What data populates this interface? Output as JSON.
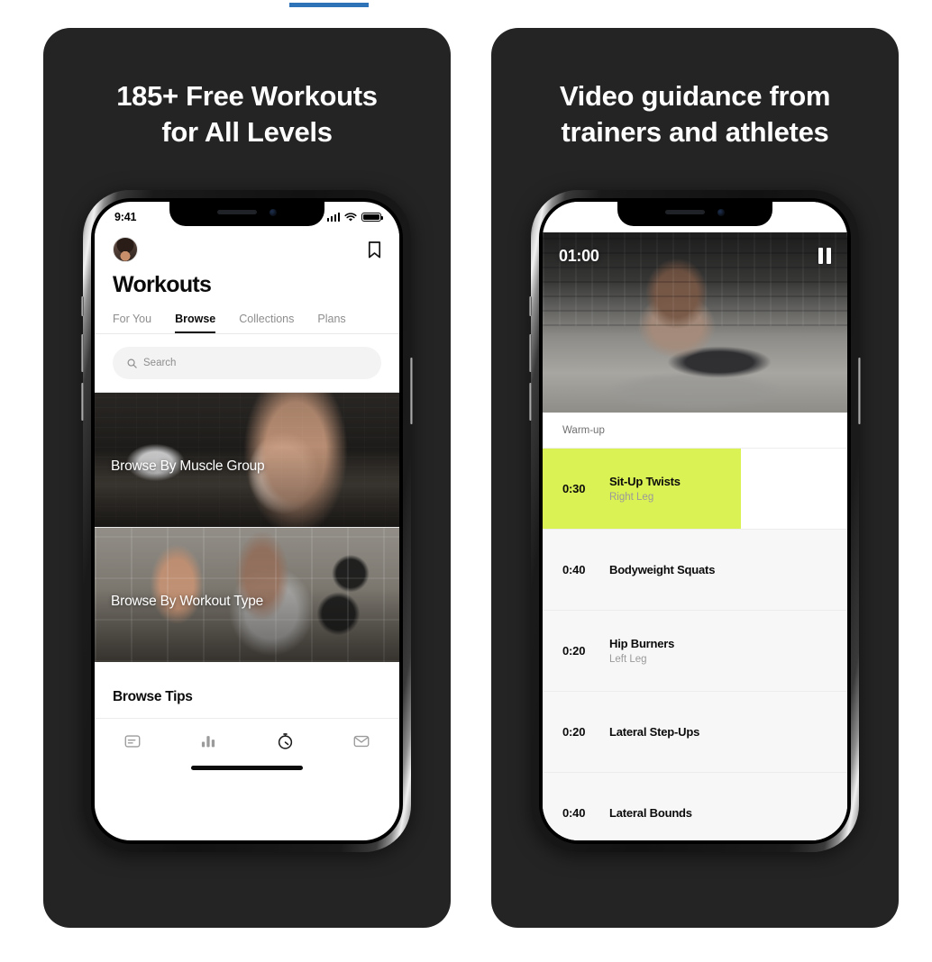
{
  "page_indicator": {
    "color": "#2e72b8"
  },
  "cards": [
    {
      "caption_line1": "185+ Free Workouts",
      "caption_line2": "for All Levels",
      "phone": {
        "status_bar": {
          "time": "9:41",
          "signal_icon": "cellular-signal-icon",
          "wifi_icon": "wifi-icon",
          "battery_icon": "battery-icon"
        },
        "header": {
          "avatar": "user-avatar",
          "bookmark_icon": "bookmark-icon",
          "title": "Workouts"
        },
        "tabs": [
          {
            "label": "For You",
            "active": false
          },
          {
            "label": "Browse",
            "active": true
          },
          {
            "label": "Collections",
            "active": false
          },
          {
            "label": "Plans",
            "active": false
          }
        ],
        "search": {
          "placeholder": "Search",
          "icon": "search-icon"
        },
        "promos": [
          {
            "label": "Browse By Muscle Group"
          },
          {
            "label": "Browse By Workout Type"
          }
        ],
        "tips_title": "Browse Tips",
        "tabbar": [
          {
            "icon": "feed-icon",
            "active": false
          },
          {
            "icon": "bar-chart-icon",
            "active": false
          },
          {
            "icon": "stopwatch-icon",
            "active": true
          },
          {
            "icon": "mail-icon",
            "active": false
          }
        ]
      }
    },
    {
      "caption_line1": "Video guidance from",
      "caption_line2": "trainers and athletes",
      "phone": {
        "player": {
          "timer": "01:00",
          "pause_icon": "pause-icon"
        },
        "section_label": "Warm-up",
        "accent_color": "#dbf254",
        "exercises": [
          {
            "time": "0:30",
            "name": "Sit-Up Twists",
            "sub": "Right Leg",
            "active": true,
            "progress": 65
          },
          {
            "time": "0:40",
            "name": "Bodyweight Squats",
            "sub": "",
            "active": false,
            "progress": 0
          },
          {
            "time": "0:20",
            "name": "Hip Burners",
            "sub": "Left Leg",
            "active": false,
            "progress": 0
          },
          {
            "time": "0:20",
            "name": "Lateral Step-Ups",
            "sub": "",
            "active": false,
            "progress": 0
          },
          {
            "time": "0:40",
            "name": "Lateral Bounds",
            "sub": "",
            "active": false,
            "progress": 0
          }
        ]
      }
    }
  ]
}
